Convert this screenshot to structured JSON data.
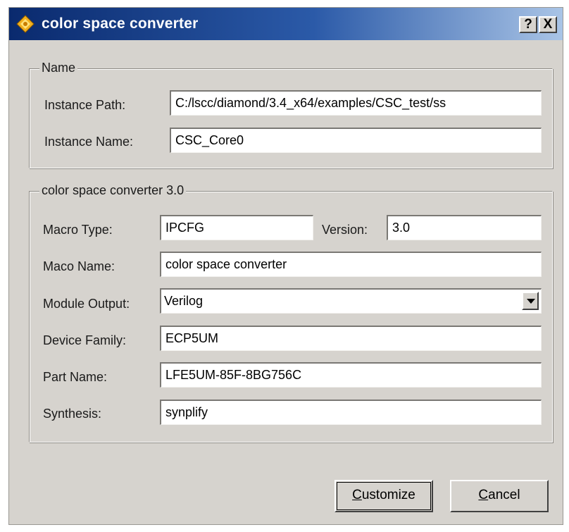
{
  "window": {
    "title": "color space converter",
    "help_label": "?",
    "close_label": "X",
    "icon": "diamond-icon"
  },
  "name_group": {
    "legend": "Name",
    "instance_path_label": "Instance Path:",
    "instance_path_value": "C:/lscc/diamond/3.4_x64/examples/CSC_test/ss",
    "instance_name_label": "Instance Name:",
    "instance_name_value": "CSC_Core0"
  },
  "csc_group": {
    "legend": "color space converter 3.0",
    "macro_type_label": "Macro Type:",
    "macro_type_value": "IPCFG",
    "version_label": "Version:",
    "version_value": "3.0",
    "maco_name_label": "Maco Name:",
    "maco_name_value": "color space converter",
    "module_output_label": "Module Output:",
    "module_output_value": "Verilog",
    "device_family_label": "Device Family:",
    "device_family_value": "ECP5UM",
    "part_name_label": "Part Name:",
    "part_name_value": "LFE5UM-85F-8BG756C",
    "synthesis_label": "Synthesis:",
    "synthesis_value": "synplify"
  },
  "buttons": {
    "customize_mnemonic": "C",
    "customize_rest": "ustomize",
    "cancel_mnemonic": "C",
    "cancel_rest": "ancel"
  }
}
